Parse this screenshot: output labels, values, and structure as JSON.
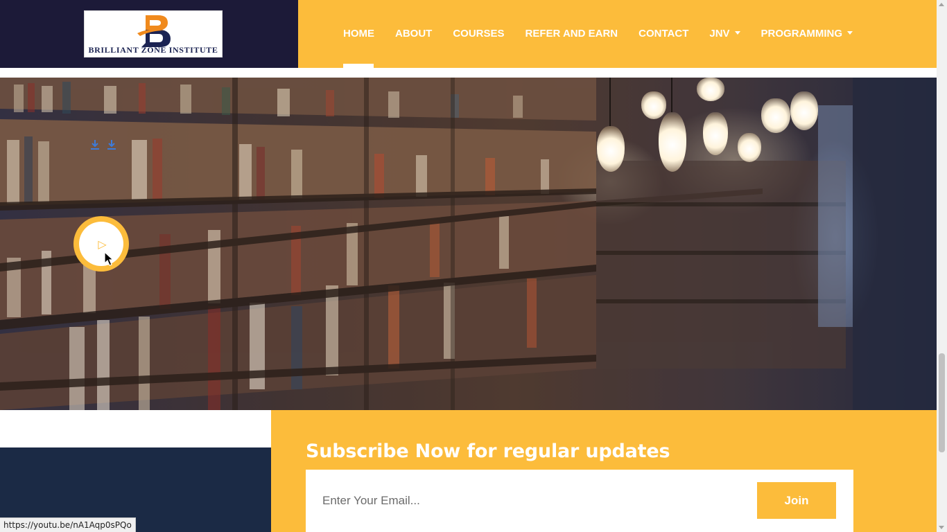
{
  "header": {
    "logo_text": "BRILLIANT ZONE INSTITUTE",
    "logo_icon": "b-monogram-logo",
    "nav_items": [
      {
        "label": "HOME",
        "active": true,
        "dropdown": false
      },
      {
        "label": "ABOUT",
        "active": false,
        "dropdown": false
      },
      {
        "label": "COURSES",
        "active": false,
        "dropdown": false
      },
      {
        "label": "REFER AND EARN",
        "active": false,
        "dropdown": false
      },
      {
        "label": "CONTACT",
        "active": false,
        "dropdown": false
      },
      {
        "label": "JNV",
        "active": false,
        "dropdown": true
      },
      {
        "label": "PROGRAMMING",
        "active": false,
        "dropdown": true
      }
    ]
  },
  "hero": {
    "background": "library-bookshelf-photo",
    "download_icons": [
      "download-icon",
      "download-icon"
    ],
    "play_button_icon": "play-icon"
  },
  "subscribe": {
    "title": "Subscribe Now for regular updates",
    "email_placeholder": "Enter Your Email...",
    "join_label": "Join"
  },
  "status_bar": {
    "url": "https://youtu.be/nA1Aqp0sPQo"
  },
  "colors": {
    "accent": "#fcbc3b",
    "header_dark": "#1c1a38",
    "footer_dark": "#1b2a45",
    "logo_navy": "#1b2352",
    "logo_orange": "#f08a1d"
  }
}
